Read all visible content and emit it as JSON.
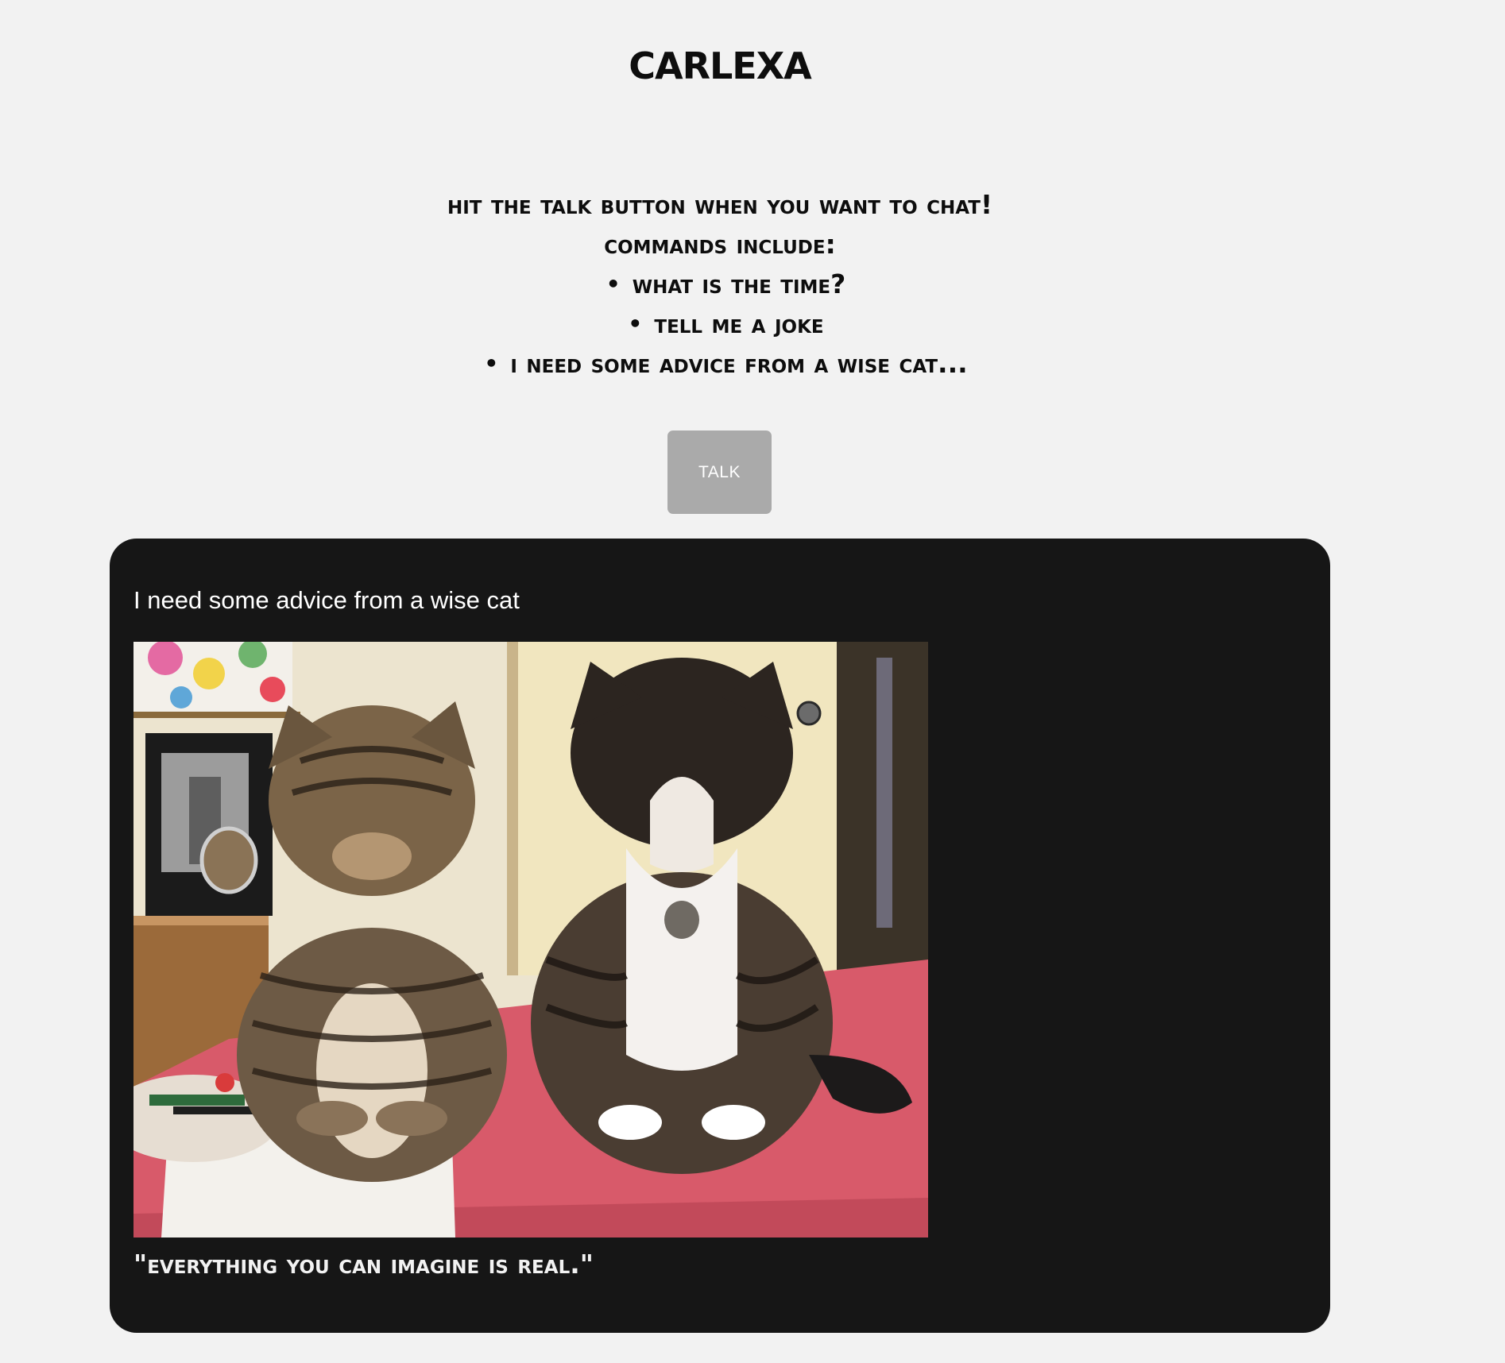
{
  "app": {
    "title": "Carlexa"
  },
  "instructions": {
    "intro": "Hit the talk button when you want to chat!",
    "commands_heading": "Commands include:",
    "commands": [
      "What is the time?",
      "Tell me a joke",
      "I need some advice from a wise cat..."
    ]
  },
  "talk_button": {
    "label": "TALK"
  },
  "chat": {
    "user_message": "I need some advice from a wise cat",
    "response_image": "two-cats-looking-down-photo",
    "response_quote": "\"Everything you can imagine is real.\""
  },
  "colors": {
    "page_background": "#f2f2f2",
    "panel_background": "#161616",
    "button_background": "#aaaaaa",
    "table_red": "#d85a6a"
  }
}
